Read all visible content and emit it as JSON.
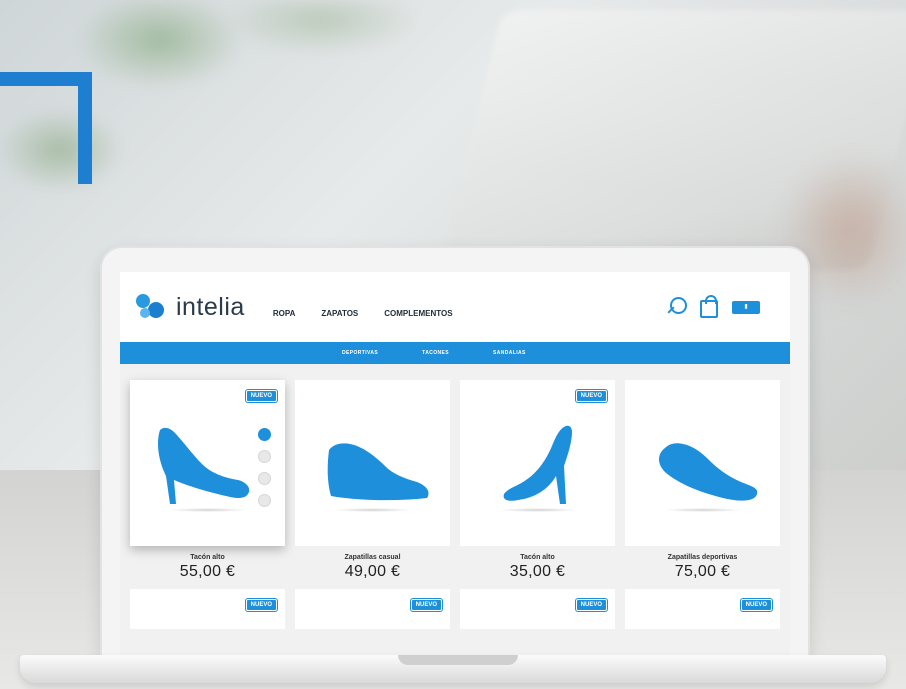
{
  "brand": {
    "name": "intelia",
    "accent": "#1e8fdb",
    "frame_color": "#1e7fd0"
  },
  "main_nav": [
    {
      "label": "ROPA"
    },
    {
      "label": "ZAPATOS"
    },
    {
      "label": "COMPLEMENTOS"
    }
  ],
  "header_icons": [
    "search-icon",
    "shopping-bag-icon",
    "cart-pill"
  ],
  "sub_nav": [
    {
      "label": "DEPORTIVAS"
    },
    {
      "label": "TACONES"
    },
    {
      "label": "SANDALIAS"
    }
  ],
  "badge_label": "NUEVO",
  "products": [
    {
      "name": "Tacón alto",
      "price": "55,00 €",
      "badge": "NUEVO",
      "icon": "high-heel-icon"
    },
    {
      "name": "Zapatillas casual",
      "price": "49,00 €",
      "badge": "",
      "icon": "casual-shoe-icon"
    },
    {
      "name": "Tacón alto",
      "price": "35,00 €",
      "badge": "NUEVO",
      "icon": "stiletto-icon"
    },
    {
      "name": "Zapatillas deportivas",
      "price": "75,00 €",
      "badge": "",
      "icon": "sneaker-icon"
    }
  ],
  "second_row_badges": [
    "NUEVO",
    "NUEVO",
    "NUEVO",
    "NUEVO"
  ]
}
